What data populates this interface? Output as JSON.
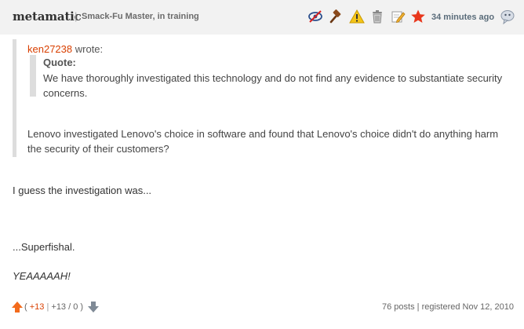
{
  "header": {
    "username": "metamatic",
    "separator": "|",
    "user_title": "Smack-Fu Master, in training",
    "timestamp": "34 minutes ago",
    "icons": [
      "hide-icon",
      "gavel-icon",
      "warning-icon",
      "trash-icon",
      "edit-icon",
      "star-icon",
      "chat-bubble-icon"
    ]
  },
  "quote": {
    "author": "ken27238",
    "wrote": "wrote:",
    "inner_label": "Quote:",
    "inner_text": "We have thoroughly investigated this technology and do not find any evidence to substantiate security concerns.",
    "body": "Lenovo investigated Lenovo's choice in software and found that Lenovo's choice didn't do anything harm the security of their customers?"
  },
  "body": {
    "paragraphs": [
      "I guess the investigation was...",
      "...Superfishal.",
      "YEAAAAAH!"
    ]
  },
  "footer": {
    "vote_open": "(",
    "vote_score": "+13",
    "vote_sep": "|",
    "vote_breakdown": "+13 / 0",
    "vote_close": ")",
    "post_count": "76 posts",
    "stats_sep": "|",
    "registered": "registered Nov 12, 2010"
  },
  "colors": {
    "header_bg": "#f2f2f2",
    "accent_orange": "#d93f00",
    "timestamp_blue": "#5a6c7a",
    "quote_bar": "#dddddd"
  }
}
